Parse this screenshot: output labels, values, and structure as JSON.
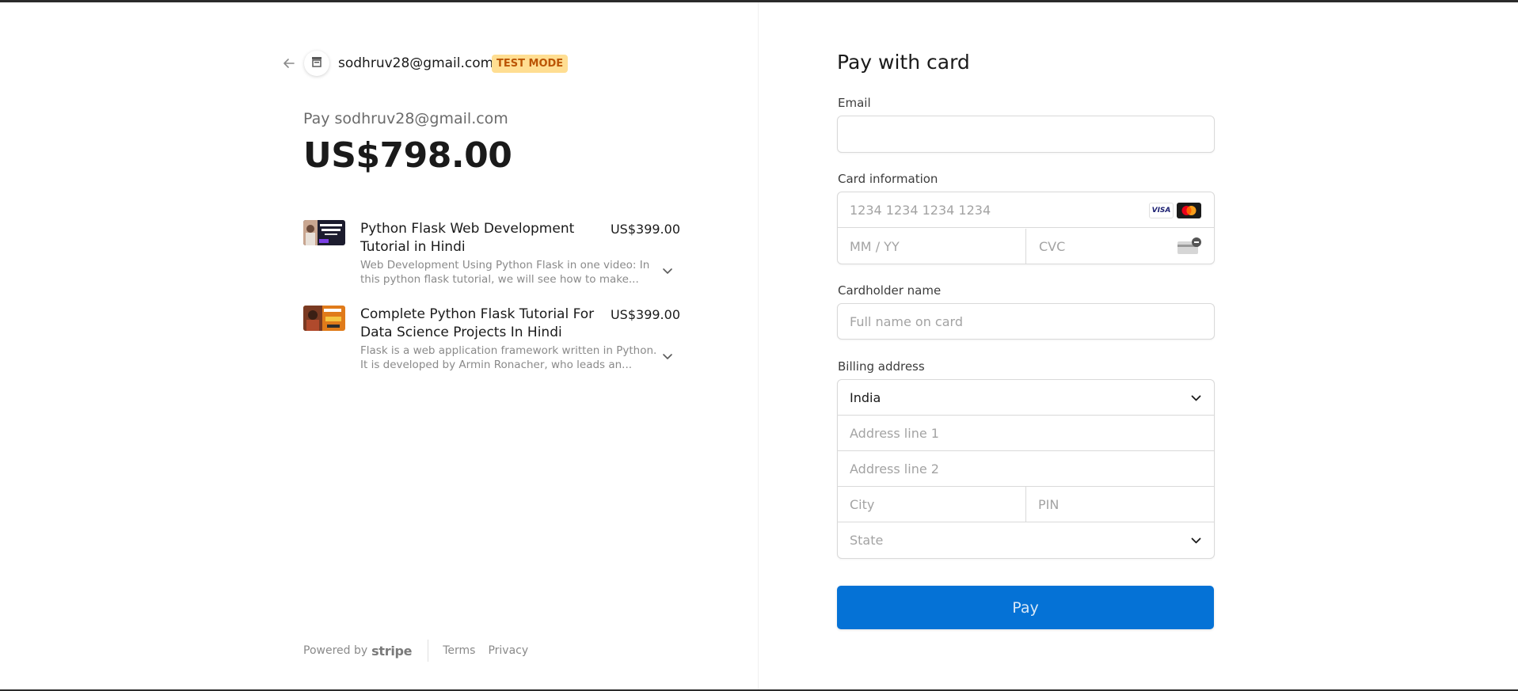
{
  "merchant": {
    "email": "sodhruv28@gmail.com",
    "badge": "TEST MODE"
  },
  "summary": {
    "pay_to": "Pay sodhruv28@gmail.com",
    "total": "US$798.00"
  },
  "line_items": [
    {
      "name": "Python Flask Web Development Tutorial in Hindi",
      "price": "US$399.00",
      "description": "Web Development Using Python Flask in one video: In this python flask tutorial, we will see how to make..."
    },
    {
      "name": "Complete Python Flask Tutorial For Data Science Projects In Hindi",
      "price": "US$399.00",
      "description": "Flask is a web application framework written in Python. It is developed by Armin Ronacher, who leads an..."
    }
  ],
  "footer": {
    "powered_by": "Powered by",
    "brand": "stripe",
    "terms": "Terms",
    "privacy": "Privacy"
  },
  "form": {
    "title": "Pay with card",
    "email_label": "Email",
    "email_value": "",
    "card_label": "Card information",
    "card_number_placeholder": "1234 1234 1234 1234",
    "expiry_placeholder": "MM / YY",
    "cvc_placeholder": "CVC",
    "card_brands": [
      "VISA",
      "mastercard"
    ],
    "cardholder_label": "Cardholder name",
    "cardholder_placeholder": "Full name on card",
    "billing_label": "Billing address",
    "country": "India",
    "address1_placeholder": "Address line 1",
    "address2_placeholder": "Address line 2",
    "city_placeholder": "City",
    "pin_placeholder": "PIN",
    "state_placeholder": "State",
    "pay_button": "Pay"
  },
  "colors": {
    "accent": "#0572d6",
    "badge_bg": "#ffde92",
    "badge_text": "#bb5504"
  }
}
